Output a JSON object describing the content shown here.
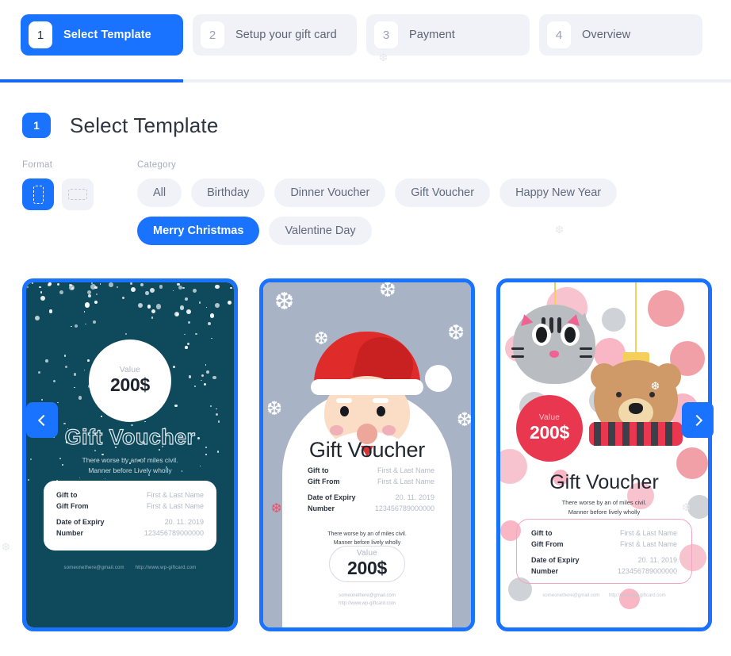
{
  "stepper": {
    "steps": [
      {
        "num": "1",
        "label": "Select Template"
      },
      {
        "num": "2",
        "label": "Setup your gift card"
      },
      {
        "num": "3",
        "label": "Payment"
      },
      {
        "num": "4",
        "label": "Overview"
      }
    ],
    "progress_percent": 25
  },
  "section": {
    "badge": "1",
    "title": "Select Template"
  },
  "filters": {
    "format_label": "Format",
    "category_label": "Category",
    "formats": [
      {
        "name": "portrait",
        "active": true
      },
      {
        "name": "landscape",
        "active": false
      }
    ],
    "categories": [
      {
        "label": "All",
        "active": false
      },
      {
        "label": "Birthday",
        "active": false
      },
      {
        "label": "Dinner Voucher",
        "active": false
      },
      {
        "label": "Gift Voucher",
        "active": false
      },
      {
        "label": "Happy New Year",
        "active": false
      },
      {
        "label": "Merry Christmas",
        "active": true
      },
      {
        "label": "Valentine Day",
        "active": false
      }
    ]
  },
  "cards": [
    {
      "theme": "snow-night",
      "value_label": "Value",
      "value_amount": "200$",
      "title": "Gift Voucher",
      "tagline_line1": "There worse by  an of miles civil.",
      "tagline_line2": "Manner before Lively wholly",
      "details": [
        {
          "key": "Gift to",
          "value": "First & Last Name"
        },
        {
          "key": "Gift From",
          "value": "First & Last Name"
        },
        {
          "key": "Date of Expiry",
          "value": "20. 11. 2019"
        },
        {
          "key": "Number",
          "value": "123456789000000"
        }
      ],
      "footer_email": "someonethere@gmail.com",
      "footer_url": "http://www.wp-giftcard.com"
    },
    {
      "theme": "santa",
      "value_label": "Value",
      "value_amount": "200$",
      "title": "Gift Voucher",
      "tagline_line1": "There worse by  an of miles civil.",
      "tagline_line2": "Manner before lively wholly",
      "details": [
        {
          "key": "Gift to",
          "value": "First & Last Name"
        },
        {
          "key": "Gift From",
          "value": "First & Last Name"
        },
        {
          "key": "Date of Expiry",
          "value": "20. 11. 2019"
        },
        {
          "key": "Number",
          "value": "123456789000000"
        }
      ],
      "footer_email": "someonethere@gmail.com",
      "footer_url": "http://www.wp-giftcard.com"
    },
    {
      "theme": "pets",
      "value_label": "Value",
      "value_amount": "200$",
      "title": "Gift Voucher",
      "tagline_line1": "There worse by  an of miles civil.",
      "tagline_line2": "Manner before lively wholly",
      "details": [
        {
          "key": "Gift to",
          "value": "First & Last Name"
        },
        {
          "key": "Gift From",
          "value": "First & Last Name"
        },
        {
          "key": "Date of Expiry",
          "value": "20. 11. 2019"
        },
        {
          "key": "Number",
          "value": "123456789000000"
        }
      ],
      "footer_email": "someonethere@gmail.com",
      "footer_url": "http://www.wp-giftcard.com"
    }
  ],
  "nav": {
    "prev": "‹",
    "next": "›"
  },
  "colors": {
    "accent": "#1a73ff",
    "chip_bg": "#f1f2f8",
    "card1_bg": "#0e4a5c",
    "card2_bg": "#a8b3c6",
    "card3_accent": "#e8374f"
  },
  "decor": {
    "flake": "❆"
  }
}
